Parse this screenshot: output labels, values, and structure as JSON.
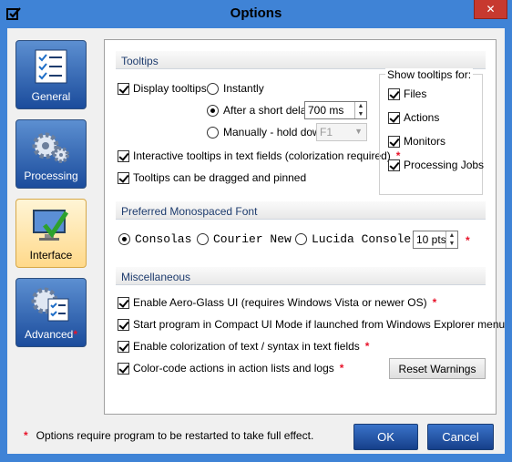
{
  "window": {
    "title": "Options",
    "close_glyph": "✕"
  },
  "nav": [
    {
      "label": "General",
      "icon": "checklist-icon",
      "active": false,
      "star": ""
    },
    {
      "label": "Processing",
      "icon": "gears-icon",
      "active": false,
      "star": ""
    },
    {
      "label": "Interface",
      "icon": "monitor-check-icon",
      "active": true,
      "star": ""
    },
    {
      "label": "Advanced",
      "icon": "gear-checklist-icon",
      "active": false,
      "star": "*"
    }
  ],
  "tooltips": {
    "header": "Tooltips",
    "display_label": "Display tooltips:",
    "instantly": "Instantly",
    "after_delay": "After a short delay:",
    "delay_value": "700 ms",
    "manually": "Manually - hold down:",
    "hold_key": "F1",
    "interactive": "Interactive tooltips in text fields (colorization required)",
    "interactive_star": "*",
    "drag_pin": "Tooltips can be dragged and pinned",
    "show_for_title": "Show tooltips for:",
    "show_for": [
      "Files",
      "Actions",
      "Monitors",
      "Processing Jobs"
    ]
  },
  "font": {
    "header": "Preferred Monospaced Font",
    "options": [
      "Consolas",
      "Courier New",
      "Lucida Console"
    ],
    "size": "10 pts",
    "star": "*"
  },
  "misc": {
    "header": "Miscellaneous",
    "items": [
      {
        "label": "Enable Aero-Glass UI (requires Windows Vista or newer OS)",
        "star": "*"
      },
      {
        "label": "Start program in Compact UI Mode if launched from Windows Explorer menu",
        "star": ""
      },
      {
        "label": "Enable colorization of text / syntax in text fields",
        "star": "*"
      },
      {
        "label": "Color-code actions in action lists and logs",
        "star": "*"
      }
    ],
    "reset_button": "Reset Warnings"
  },
  "footer": {
    "star": "*",
    "note": "Options require program to be restarted to take full effect.",
    "ok": "OK",
    "cancel": "Cancel"
  },
  "colors": {
    "accent": "#3f83d6",
    "star": "#e8132a",
    "selected_nav": "#ffd98a"
  }
}
